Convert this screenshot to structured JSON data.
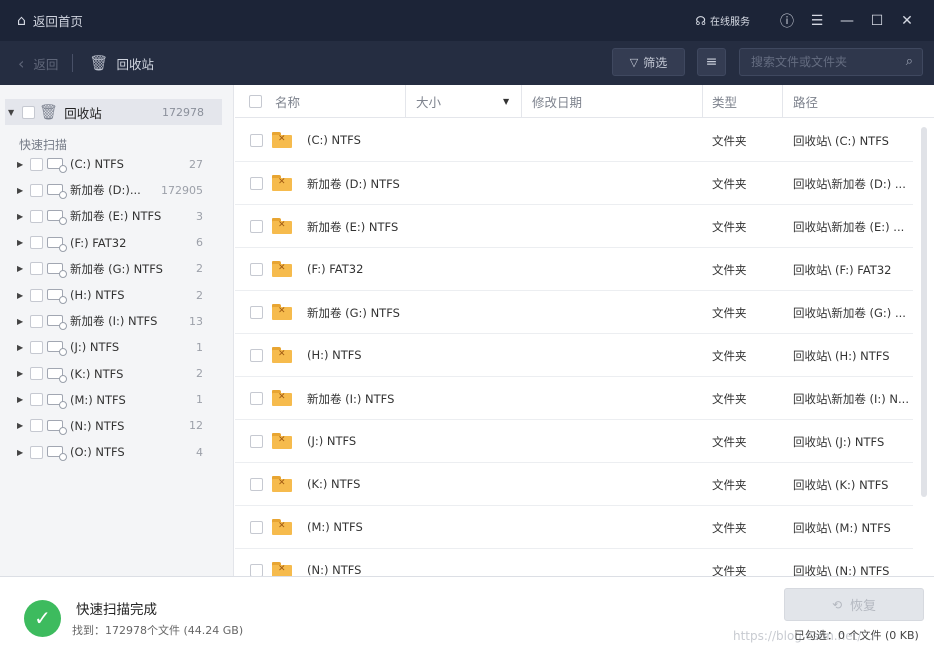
{
  "titlebar": {
    "home_label": "返回首页",
    "service_label": "在线服务"
  },
  "toolbar": {
    "back_label": "返回",
    "breadcrumb": "回收站",
    "filter_label": "筛选",
    "search_placeholder": "搜索文件或文件夹"
  },
  "sidebar": {
    "root": {
      "label": "回收站",
      "count": "172978"
    },
    "section_label": "快速扫描",
    "drives": [
      {
        "label": "(C:) NTFS",
        "count": "27"
      },
      {
        "label": "新加卷 (D:)...",
        "count": "172905"
      },
      {
        "label": "新加卷 (E:) NTFS",
        "count": "3"
      },
      {
        "label": "(F:) FAT32",
        "count": "6"
      },
      {
        "label": "新加卷 (G:) NTFS",
        "count": "2"
      },
      {
        "label": "(H:) NTFS",
        "count": "2"
      },
      {
        "label": "新加卷 (I:) NTFS",
        "count": "13"
      },
      {
        "label": "(J:) NTFS",
        "count": "1"
      },
      {
        "label": "(K:) NTFS",
        "count": "2"
      },
      {
        "label": "(M:) NTFS",
        "count": "1"
      },
      {
        "label": "(N:) NTFS",
        "count": "12"
      },
      {
        "label": "(O:) NTFS",
        "count": "4"
      }
    ]
  },
  "table": {
    "columns": {
      "name": "名称",
      "size": "大小",
      "modified": "修改日期",
      "type": "类型",
      "path": "路径"
    },
    "rows": [
      {
        "name": "(C:) NTFS",
        "type": "文件夹",
        "path": "回收站\\ (C:) NTFS"
      },
      {
        "name": "新加卷 (D:) NTFS",
        "type": "文件夹",
        "path": "回收站\\新加卷 (D:) ..."
      },
      {
        "name": "新加卷 (E:) NTFS",
        "type": "文件夹",
        "path": "回收站\\新加卷 (E:) ..."
      },
      {
        "name": "(F:) FAT32",
        "type": "文件夹",
        "path": "回收站\\ (F:) FAT32"
      },
      {
        "name": "新加卷 (G:) NTFS",
        "type": "文件夹",
        "path": "回收站\\新加卷 (G:) ..."
      },
      {
        "name": "(H:) NTFS",
        "type": "文件夹",
        "path": "回收站\\ (H:) NTFS"
      },
      {
        "name": "新加卷 (I:) NTFS",
        "type": "文件夹",
        "path": "回收站\\新加卷 (I:) N..."
      },
      {
        "name": "(J:) NTFS",
        "type": "文件夹",
        "path": "回收站\\ (J:) NTFS"
      },
      {
        "name": "(K:) NTFS",
        "type": "文件夹",
        "path": "回收站\\ (K:) NTFS"
      },
      {
        "name": "(M:) NTFS",
        "type": "文件夹",
        "path": "回收站\\ (M:) NTFS"
      },
      {
        "name": "(N:) NTFS",
        "type": "文件夹",
        "path": "回收站\\ (N:) NTFS"
      }
    ]
  },
  "footer": {
    "status_title": "快速扫描完成",
    "found_text": "找到：172978个文件 (44.24 GB)",
    "recover_label": "恢复",
    "selected_text": "已勾选：0 个文件 (0 KB)",
    "watermark": "https://blog.csdn.net/..."
  },
  "colors": {
    "titlebar_bg": "#1c2437",
    "toolbar_bg": "#252d41",
    "success_green": "#3dbb5e",
    "folder_orange": "#f6bb4d"
  }
}
